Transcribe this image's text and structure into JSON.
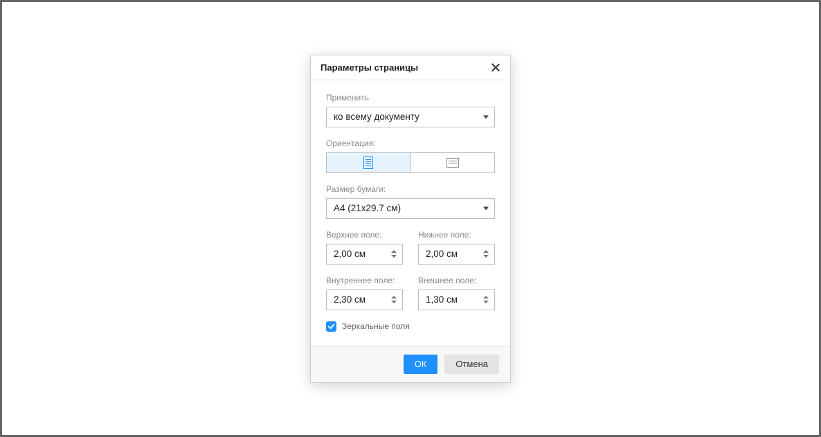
{
  "dialog": {
    "title": "Параметры страницы",
    "apply": {
      "label": "Применить",
      "value": "ко всему документу"
    },
    "orientation": {
      "label": "Ориентация:"
    },
    "paper_size": {
      "label": "Размер бумаги:",
      "value": "A4 (21x29.7 см)"
    },
    "margins": {
      "top": {
        "label": "Верхнее поле:",
        "value": "2,00 см"
      },
      "bottom": {
        "label": "Нижнее поле:",
        "value": "2,00 см"
      },
      "inner": {
        "label": "Внутреннее поле:",
        "value": "2,30 см"
      },
      "outer": {
        "label": "Внешнее поле:",
        "value": "1,30 см"
      }
    },
    "mirror": {
      "label": "Зеркальные поля",
      "checked": true
    },
    "buttons": {
      "ok": "ОК",
      "cancel": "Отмена"
    }
  }
}
